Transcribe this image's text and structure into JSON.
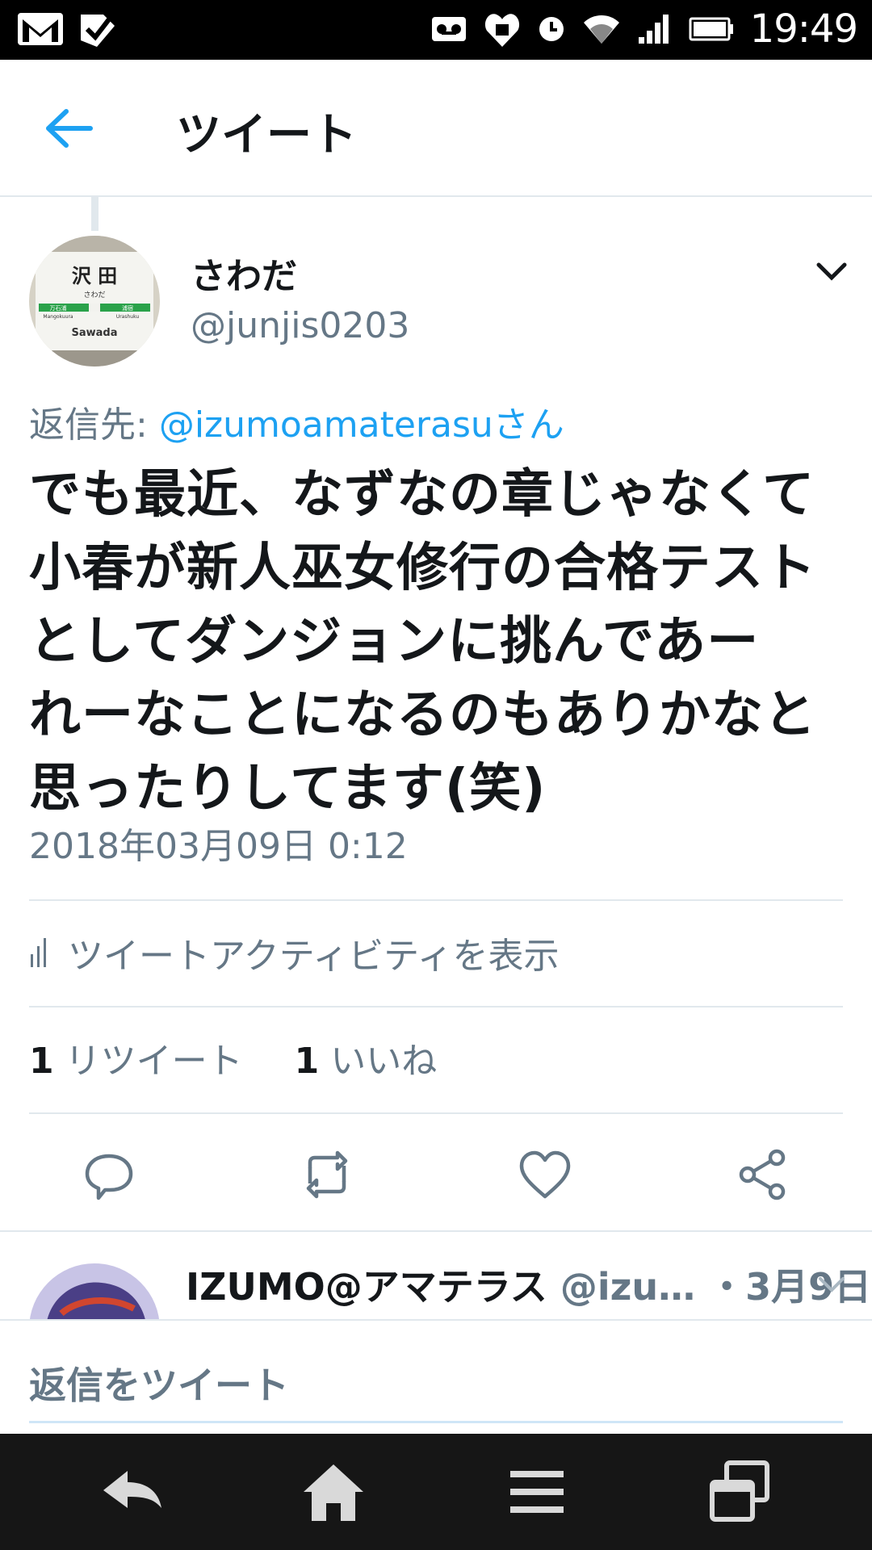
{
  "status_bar": {
    "time": "19:49",
    "left_icons": [
      "gmail-icon",
      "task-check-icon"
    ],
    "right_icons": [
      "voicemail-icon",
      "heart-shield-icon",
      "alarm-icon",
      "wifi-icon",
      "signal-icon",
      "battery-icon"
    ]
  },
  "header": {
    "title": "ツイート",
    "back_icon": "arrow-left-icon"
  },
  "tweet": {
    "author_name": "さわだ",
    "author_handle": "@junjis0203",
    "reply_to_prefix": "返信先: ",
    "reply_to_mention": "@izumoamaterasuさん",
    "text_lines": [
      "でも最近、なずなの章じゃなくて",
      "小春が新人巫女修行の合格テスト",
      "としてダンジョンに挑んであー",
      "れーなことになるのもありかなと",
      "思ったりしてます(笑)"
    ],
    "timestamp": "2018年03月09日 0:12",
    "activity_label": "ツイートアクティビティを表示",
    "retweet_count": "1",
    "retweet_label": "リツイート",
    "like_count": "1",
    "like_label": "いいね"
  },
  "avatar_sign": {
    "kanji": "沢 田",
    "kana": "さわだ",
    "left_station": "万石浦",
    "right_station": "浦宿",
    "left_romaji": "Mangokuura",
    "right_romaji": "Urashuku",
    "romaji": "Sawada"
  },
  "reply_preview": {
    "name": "IZUMO@アマテラス",
    "handle": "@izu…",
    "date": "・3月9日"
  },
  "composer": {
    "placeholder": "返信をツイート"
  },
  "colors": {
    "accent": "#1da1f2",
    "secondary_text": "#657786",
    "divider": "#e1e8ed",
    "nav_bg": "#161616"
  }
}
